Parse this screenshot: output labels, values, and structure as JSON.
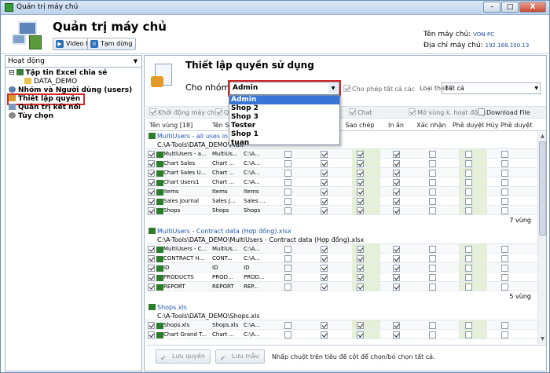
{
  "window": {
    "title": "Quản trị máy chủ",
    "controls": [
      "–",
      "□",
      "X"
    ]
  },
  "header": {
    "app_title": "Quản trị máy chủ",
    "video_help": "Video Help",
    "pause": "Tạm dừng",
    "server_name_label": "Tên máy chủ:",
    "server_name": "VON-PC",
    "server_ip_label": "Địa chỉ máy chủ:",
    "server_ip": "192.168.100.13"
  },
  "sidebar": {
    "dropdown": "Hoạt động",
    "items": [
      {
        "label": "Tập tin Excel chia sẻ",
        "indent": 0,
        "expanded": true
      },
      {
        "label": "DATA_DEMO",
        "indent": 1
      },
      {
        "label": "Nhóm và Người dùng (users)",
        "indent": 0
      },
      {
        "label": "Thiết lập quyền",
        "indent": 0,
        "selected": true
      },
      {
        "label": "Quản trị kết nối",
        "indent": 0
      },
      {
        "label": "Tùy chọn",
        "indent": 0
      }
    ]
  },
  "main": {
    "title": "Thiết lập quyền sử dụng",
    "group_label": "Cho nhóm:",
    "group_value": "Admin",
    "group_options": [
      "Admin",
      "Shop 2",
      "Shop 3",
      "Tester",
      "Shop 1",
      "tuan"
    ],
    "allow_all": "Cho phép tất cả các",
    "loai_label": "Loại theo:",
    "loai_value": "Tất cả",
    "filters": [
      "Khởi động máy chủ",
      "Chat",
      "Mở vùng k. hoạt động",
      "Download File"
    ],
    "columns": [
      "Tên vùng [18]",
      "Tên Sh",
      "Sao chép",
      "In ấn",
      "Xác nhận",
      "Phê duyệt",
      "Hủy Phê duyệt"
    ],
    "groups": [
      {
        "title": "MultiUsers - all uses in a",
        "path": "C:\\A-Tools\\DATA_DEMO\\Mult",
        "rows": [
          [
            "MultiUsers - a...",
            "MultiUs...",
            "C:\\A..."
          ],
          [
            "Chart Sales",
            "Chart ...",
            "C:\\A..."
          ],
          [
            "Chart Sales U...",
            "Chart ...",
            "C:\\A..."
          ],
          [
            "Chart Users1",
            "Chart ...",
            "C:\\A..."
          ],
          [
            "Items",
            "Items",
            "Items"
          ],
          [
            "Sales Journal",
            "Sales J...",
            "Sales ..."
          ],
          [
            "Shops",
            "Shops",
            "Shops"
          ]
        ],
        "count": "7 vùng"
      },
      {
        "title": "MultiUsers - Contract data (Hợp đồng).xlsx",
        "path": "C:\\A-Tools\\DATA_DEMO\\MultiUsers - Contract data (Hợp đồng).xlsx",
        "rows": [
          [
            "MultiUsers - C...",
            "MultiUs...",
            "C:\\A..."
          ],
          [
            "CONTRACT H...",
            "CONT...",
            "C:\\A..."
          ],
          [
            "ID",
            "ID",
            "ID"
          ],
          [
            "PRODUCTS",
            "PROD...",
            "PROD..."
          ],
          [
            "REPORT",
            "REPORT",
            "REP..."
          ]
        ],
        "count": "5 vùng"
      },
      {
        "title": "Shops.xls",
        "path": "C:\\A-Tools\\DATA_DEMO\\Shops.xls",
        "rows": [
          [
            "Shops.xls",
            "Shops.xls",
            "C:\\A..."
          ],
          [
            "Chart Grand T...",
            "Chart ...",
            "C:\\A..."
          ]
        ],
        "count": ""
      }
    ],
    "save_label": "Lưu quyền",
    "save_template_label": "Lưu mẫu",
    "hint": "Nhấp chuột trên tiêu đề cột để chọn/bỏ chọn tất cả."
  },
  "colors": {
    "accent": "#d42727",
    "link": "#1f57b0",
    "green_col": "#e6f0d8"
  }
}
